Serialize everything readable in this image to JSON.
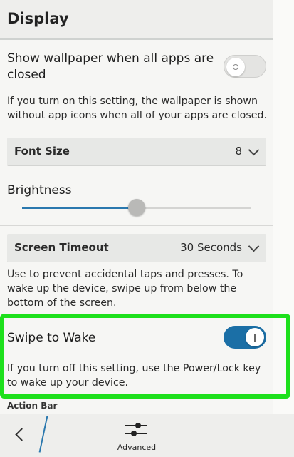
{
  "header": {
    "title": "Display"
  },
  "wallpaper": {
    "title_line1": "Show wallpaper when all apps are",
    "title_line2": "closed",
    "desc_line1": "If you turn on this setting, the wallpaper is shown",
    "desc_line2": "without app icons when all of your apps are closed.",
    "enabled": false
  },
  "font_size": {
    "label": "Font Size",
    "value": "8"
  },
  "brightness": {
    "label": "Brightness",
    "level": 0.5
  },
  "screen_timeout": {
    "label": "Screen Timeout",
    "value": "30 Seconds",
    "desc_line1": "Use to prevent accidental taps and presses. To",
    "desc_line2": "wake up the device, swipe up from below the",
    "desc_line3": "bottom of the screen."
  },
  "swipe_to_wake": {
    "title": "Swipe to Wake",
    "desc_line1": "If you turn off this setting, use the Power/Lock key",
    "desc_line2": "to wake up your device.",
    "enabled": true
  },
  "next_section": "Action Bar",
  "bottom_bar": {
    "advanced_label": "Advanced"
  },
  "colors": {
    "accent": "#1b6fa6",
    "highlight": "#1de01c"
  },
  "icons": {
    "back": "chevron-left-icon",
    "advanced": "sliders-icon"
  }
}
